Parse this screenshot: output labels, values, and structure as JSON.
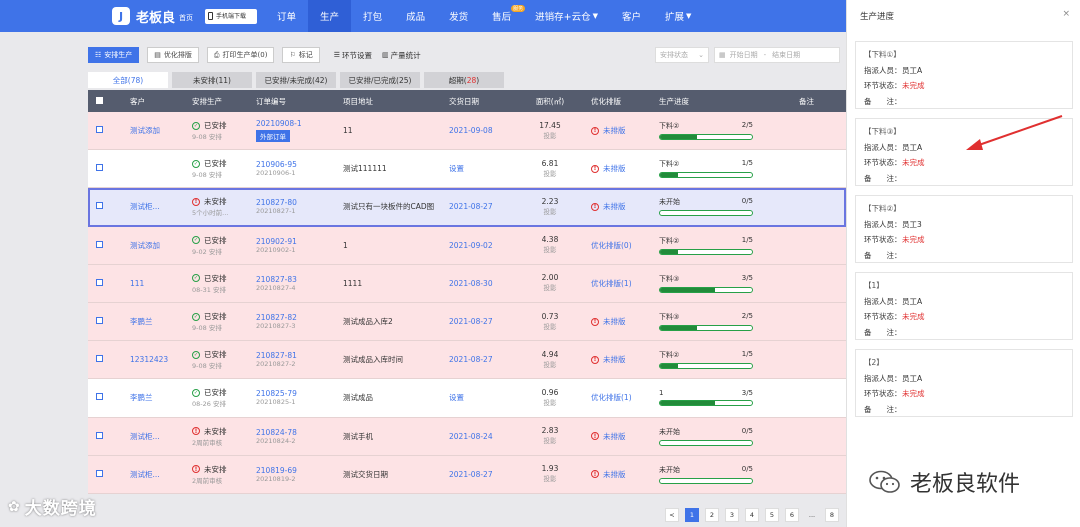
{
  "header": {
    "logo_glyph": "J",
    "app_name": "老板良",
    "home_label": "首页",
    "download_label": "手机端下载",
    "nav": [
      {
        "label": "订单",
        "active": false
      },
      {
        "label": "生产",
        "active": true
      },
      {
        "label": "打包",
        "active": false
      },
      {
        "label": "成品",
        "active": false
      },
      {
        "label": "发货",
        "active": false
      },
      {
        "label": "售后",
        "active": false,
        "badge": "服务"
      },
      {
        "label": "进销存+云仓",
        "active": false,
        "dropdown": true
      },
      {
        "label": "客户",
        "active": false
      },
      {
        "label": "扩展",
        "active": false,
        "dropdown": true
      }
    ]
  },
  "toolbar": {
    "arrange_label": "安排生产",
    "optimize_label": "优化排版",
    "print_label": "打印生产单(0)",
    "mark_label": "标记",
    "step_setting_label": "环节设置",
    "output_stats_label": "产量统计",
    "status_placeholder": "安排状态",
    "start_date_placeholder": "开始日期",
    "date_sep": "-",
    "end_date_placeholder": "结束日期"
  },
  "tabs": [
    {
      "label": "全部",
      "count": "78",
      "active": true
    },
    {
      "label": "未安排",
      "count": "11",
      "active": false
    },
    {
      "label": "已安排/未完成",
      "count": "42",
      "active": false
    },
    {
      "label": "已安排/已完成",
      "count": "25",
      "active": false
    },
    {
      "label": "超期",
      "count": "28",
      "active": false,
      "red_count": true
    }
  ],
  "table": {
    "headers": [
      "客户",
      "安排生产",
      "订单编号",
      "项目地址",
      "交货日期",
      "面积(㎡)",
      "优化排版",
      "生产进度",
      "备注"
    ],
    "rows": [
      {
        "bg": "pink",
        "customer": "测试添加",
        "status": "已安排",
        "status_ok": true,
        "status_sub": "9-08 安排",
        "order_no": "20210908-1",
        "order_sub": "",
        "order_tag": "外部订单",
        "address": "11",
        "delivery": "2021-09-08",
        "delivery_color": "blue",
        "area": "17.45",
        "area_sub": "投影",
        "optimize": "未排版",
        "optimize_warn": true,
        "progress_label": "下料②",
        "progress_count": "2/5",
        "progress": 0.4
      },
      {
        "bg": "white",
        "customer": "",
        "status": "已安排",
        "status_ok": true,
        "status_sub": "9-08 安排",
        "order_no": "210906-95",
        "order_sub": "20210906-1",
        "order_tag": "",
        "address": "测试111111",
        "delivery": "设置",
        "delivery_color": "blue",
        "area": "6.81",
        "area_sub": "投影",
        "optimize": "未排版",
        "optimize_warn": true,
        "progress_label": "下料②",
        "progress_count": "1/5",
        "progress": 0.2
      },
      {
        "bg": "sel",
        "customer": "测试柜...",
        "status": "未安排",
        "status_ok": false,
        "status_sub": "5个小时前...",
        "order_no": "210827-80",
        "order_sub": "20210827-1",
        "order_tag": "",
        "address": "测试只有一块板件的CAD图",
        "delivery": "2021-08-27",
        "delivery_color": "blue",
        "area": "2.23",
        "area_sub": "投影",
        "optimize": "未排版",
        "optimize_warn": true,
        "progress_label": "未开始",
        "progress_count": "0/5",
        "progress": 0
      },
      {
        "bg": "pink",
        "customer": "测试添加",
        "status": "已安排",
        "status_ok": true,
        "status_sub": "9-02 安排",
        "order_no": "210902-91",
        "order_sub": "20210902-1",
        "order_tag": "",
        "address": "1",
        "delivery": "2021-09-02",
        "delivery_color": "blue",
        "area": "4.38",
        "area_sub": "投影",
        "optimize": "优化排版(0)",
        "optimize_warn": false,
        "progress_label": "下料②",
        "progress_count": "1/5",
        "progress": 0.2
      },
      {
        "bg": "pink",
        "customer": "111",
        "status": "已安排",
        "status_ok": true,
        "status_sub": "08-31 安排",
        "order_no": "210827-83",
        "order_sub": "20210827-4",
        "order_tag": "",
        "address": "1111",
        "delivery": "2021-08-30",
        "delivery_color": "blue",
        "area": "2.00",
        "area_sub": "投影",
        "optimize": "优化排版(1)",
        "optimize_warn": false,
        "progress_label": "下料③",
        "progress_count": "3/5",
        "progress": 0.6
      },
      {
        "bg": "pink",
        "customer": "李鹏兰",
        "status": "已安排",
        "status_ok": true,
        "status_sub": "9-08 安排",
        "order_no": "210827-82",
        "order_sub": "20210827-3",
        "order_tag": "",
        "address": "测试成品入库2",
        "delivery": "2021-08-27",
        "delivery_color": "blue",
        "area": "0.73",
        "area_sub": "投影",
        "optimize": "未排版",
        "optimize_warn": true,
        "progress_label": "下料③",
        "progress_count": "2/5",
        "progress": 0.4
      },
      {
        "bg": "pink",
        "customer": "12312423",
        "status": "已安排",
        "status_ok": true,
        "status_sub": "9-08 安排",
        "order_no": "210827-81",
        "order_sub": "20210827-2",
        "order_tag": "",
        "address": "测试成品入库时间",
        "delivery": "2021-08-27",
        "delivery_color": "blue",
        "area": "4.94",
        "area_sub": "投影",
        "optimize": "未排版",
        "optimize_warn": true,
        "progress_label": "下料②",
        "progress_count": "1/5",
        "progress": 0.2
      },
      {
        "bg": "white",
        "customer": "李鹏兰",
        "status": "已安排",
        "status_ok": true,
        "status_sub": "08-26 安排",
        "order_no": "210825-79",
        "order_sub": "20210825-1",
        "order_tag": "",
        "address": "测试成品",
        "delivery": "设置",
        "delivery_color": "blue",
        "area": "0.96",
        "area_sub": "投影",
        "optimize": "优化排版(1)",
        "optimize_warn": false,
        "progress_label": "1",
        "progress_count": "3/5",
        "progress": 0.6
      },
      {
        "bg": "pink",
        "customer": "测试柜...",
        "status": "未安排",
        "status_ok": false,
        "status_sub": "2周前审核",
        "order_no": "210824-78",
        "order_sub": "20210824-2",
        "order_tag": "",
        "address": "测试手机",
        "delivery": "2021-08-24",
        "delivery_color": "blue",
        "area": "2.83",
        "area_sub": "投影",
        "optimize": "未排版",
        "optimize_warn": true,
        "progress_label": "未开始",
        "progress_count": "0/5",
        "progress": 0
      },
      {
        "bg": "pink",
        "customer": "测试柜...",
        "status": "未安排",
        "status_ok": false,
        "status_sub": "2周前审核",
        "order_no": "210819-69",
        "order_sub": "20210819-2",
        "order_tag": "",
        "address": "测试交货日期",
        "delivery": "2021-08-27",
        "delivery_color": "blue",
        "area": "1.93",
        "area_sub": "投影",
        "optimize": "未排版",
        "optimize_warn": true,
        "progress_label": "未开始",
        "progress_count": "0/5",
        "progress": 0
      }
    ]
  },
  "pagination": {
    "prev": "<",
    "pages": [
      "1",
      "2",
      "3",
      "4",
      "5",
      "6",
      "...",
      "8"
    ],
    "active": "1"
  },
  "panel": {
    "title": "生产进度",
    "close": "×",
    "assignee_label": "指派人员：",
    "status_label": "环节状态：",
    "note_label": "备　　注：",
    "cards": [
      {
        "title": "【下料①】",
        "assignee": "员工A",
        "status": "未完成",
        "note": ""
      },
      {
        "title": "【下料③】",
        "assignee": "员工A",
        "status": "未完成",
        "note": ""
      },
      {
        "title": "【下料②】",
        "assignee": "员工3",
        "status": "未完成",
        "note": ""
      },
      {
        "title": "【1】",
        "assignee": "员工A",
        "status": "未完成",
        "note": ""
      },
      {
        "title": "【2】",
        "assignee": "员工A",
        "status": "未完成",
        "note": ""
      }
    ]
  },
  "watermarks": {
    "left": "大数跨境",
    "right": "老板良软件"
  },
  "colors": {
    "primary": "#3f73e8",
    "danger": "#e03030",
    "success": "#27a047",
    "row_overdue": "#fde3e5",
    "header_bg": "#555c6e"
  }
}
